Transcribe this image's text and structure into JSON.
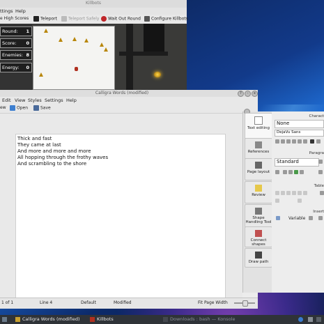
{
  "killbots": {
    "title": "Killbots",
    "menu": [
      "ttings",
      "Help"
    ],
    "toolbar": [
      {
        "label": "e High Scores",
        "icon": "high-scores-icon",
        "disabled": false
      },
      {
        "label": "Teleport",
        "icon": "teleport-icon",
        "disabled": false
      },
      {
        "label": "Teleport Safely",
        "icon": "teleport-safely-icon",
        "disabled": true
      },
      {
        "label": "Wait Out Round",
        "icon": "wait-out-round-icon",
        "disabled": false
      },
      {
        "label": "Configure Killbots",
        "icon": "configure-icon",
        "disabled": false
      }
    ],
    "stats": [
      {
        "label": "Round:",
        "value": "1"
      },
      {
        "label": "Score:",
        "value": "0"
      },
      {
        "label": "Enemies:",
        "value": "8"
      },
      {
        "label": "Energy:",
        "value": "0"
      }
    ]
  },
  "words": {
    "title": "Calligra Words (modified)",
    "menu": [
      "Edit",
      "View",
      "Styles",
      "Settings",
      "Help"
    ],
    "toolbar": [
      {
        "label": "ew",
        "icon": "new-doc-icon"
      },
      {
        "label": "Open",
        "icon": "open-folder-icon"
      },
      {
        "label": "Save",
        "icon": "save-icon"
      }
    ],
    "document_lines": [
      "Thick and fast",
      "They came at last",
      "And more and more and more",
      "All hopping through the frothy waves",
      "And scrambling to the shore"
    ],
    "status": {
      "page": "1 of 1",
      "line": "Line 4",
      "style": "Default",
      "modified": "Modified",
      "zoom": "Fit Page Width"
    }
  },
  "docker": {
    "tabs": [
      {
        "label": "Text editing",
        "icon": "text-editing-icon"
      },
      {
        "label": "References",
        "icon": "references-icon"
      },
      {
        "label": "Page layout",
        "icon": "page-layout-icon"
      },
      {
        "label": "Review",
        "icon": "review-icon"
      },
      {
        "label": "Shape Handling Tool",
        "icon": "shape-handling-icon"
      },
      {
        "label": "Connect shapes",
        "icon": "connect-shapes-icon"
      },
      {
        "label": "Draw path",
        "icon": "draw-path-icon"
      }
    ],
    "character_title": "Charact",
    "style_value": "None",
    "font_value": "DejaVu Sans",
    "paragraph_title": "Paragra",
    "paragraph_style": "Standard",
    "table_title": "Table",
    "insert_title": "Insert",
    "variable_label": "Variable"
  },
  "taskbar": {
    "items": [
      {
        "label": "Calligra Words (modified)",
        "dim": false
      },
      {
        "label": "Killbots",
        "dim": false
      },
      {
        "label": "Downloads : bash — Konsole",
        "dim": true
      }
    ]
  }
}
